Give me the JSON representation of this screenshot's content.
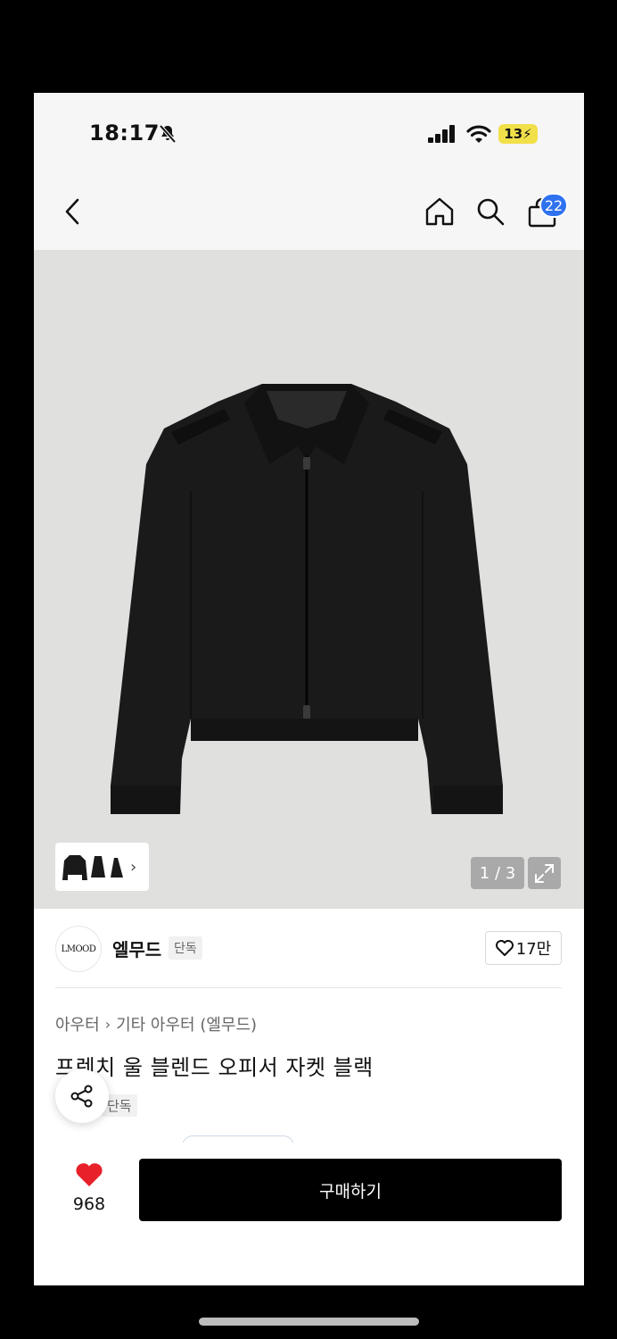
{
  "status_bar": {
    "time": "18:17",
    "battery": "13"
  },
  "nav": {
    "cart_count": "22"
  },
  "gallery": {
    "pager": "1 / 3"
  },
  "brand": {
    "logo_text": "LMOOD",
    "name": "엘무드",
    "tag": "단독"
  },
  "like": {
    "count": "17만"
  },
  "product": {
    "breadcrumb": [
      "아우터",
      "기타 아우터 (엘무드)"
    ],
    "title": "프렌치 울 블렌드 오피서 자켓 블랙",
    "tag": "단독"
  },
  "bottom": {
    "wish_count": "968",
    "buy_label": "구매하기"
  },
  "colors": {
    "accent_badge": "#2f72f0",
    "heart": "#e8202a",
    "button": "#000000"
  },
  "icons": [
    "back-icon",
    "home-icon",
    "search-icon",
    "shopping-bag-icon",
    "bell-slash-icon",
    "signal-icon",
    "wifi-icon",
    "expand-icon",
    "heart-outline-icon",
    "share-icon",
    "heart-filled-icon"
  ]
}
